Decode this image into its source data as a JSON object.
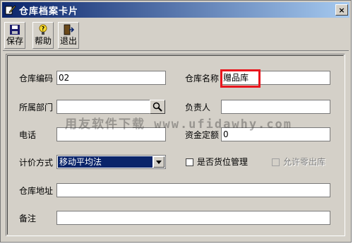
{
  "window": {
    "title": "仓库档案卡片",
    "close_glyph": "×"
  },
  "toolbar": {
    "save_label": "保存",
    "help_label": "帮助",
    "exit_label": "退出"
  },
  "form": {
    "warehouse_code_label": "仓库编码",
    "warehouse_code_value": "02",
    "warehouse_name_label": "仓库名称",
    "warehouse_name_value": "赠品库",
    "department_label": "所属部门",
    "department_value": "",
    "manager_label": "负责人",
    "manager_value": "",
    "phone_label": "电话",
    "phone_value": "",
    "quota_label": "资金定额",
    "quota_value": "0",
    "pricing_label": "计价方式",
    "pricing_value": "移动平均法",
    "location_mgmt_label": "是否货位管理",
    "allow_zero_out_label": "允许零出库",
    "address_label": "仓库地址",
    "address_value": "",
    "remark_label": "备注",
    "remark_value": ""
  },
  "watermark": "用友软件下载 www.ufidawhy.com",
  "colors": {
    "highlight": "#e8161d",
    "titlebar": "#0a246a",
    "selection": "#0a246a"
  }
}
